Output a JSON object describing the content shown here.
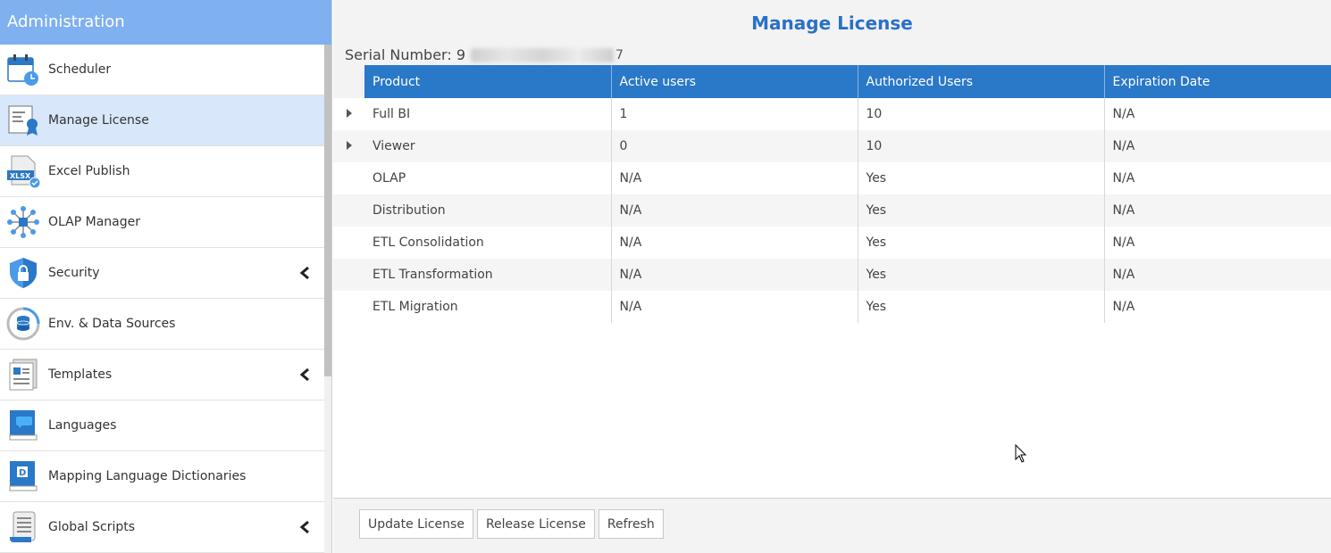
{
  "sidebar": {
    "title": "Administration",
    "items": [
      {
        "label": "Scheduler",
        "icon": "calendar-clock-icon",
        "active": false,
        "expandable": false
      },
      {
        "label": "Manage License",
        "icon": "license-certificate-icon",
        "active": true,
        "expandable": false
      },
      {
        "label": "Excel Publish",
        "icon": "xlsx-file-icon",
        "active": false,
        "expandable": false
      },
      {
        "label": "OLAP Manager",
        "icon": "olap-network-icon",
        "active": false,
        "expandable": false
      },
      {
        "label": "Security",
        "icon": "shield-lock-icon",
        "active": false,
        "expandable": true
      },
      {
        "label": "Env. & Data Sources",
        "icon": "database-icon",
        "active": false,
        "expandable": false
      },
      {
        "label": "Templates",
        "icon": "template-document-icon",
        "active": false,
        "expandable": true
      },
      {
        "label": "Languages",
        "icon": "language-book-icon",
        "active": false,
        "expandable": false
      },
      {
        "label": "Mapping Language Dictionaries",
        "icon": "dictionary-book-icon",
        "active": false,
        "expandable": false
      },
      {
        "label": "Global Scripts",
        "icon": "script-scroll-icon",
        "active": false,
        "expandable": true
      }
    ]
  },
  "main": {
    "title": "Manage License",
    "serial_label": "Serial Number: 9",
    "serial_tail": "7",
    "table": {
      "columns": [
        "Product",
        "Active users",
        "Authorized Users",
        "Expiration Date"
      ],
      "rows": [
        {
          "expandable": true,
          "cells": [
            "Full BI",
            "1",
            "10",
            "N/A"
          ]
        },
        {
          "expandable": true,
          "cells": [
            "Viewer",
            "0",
            "10",
            "N/A"
          ]
        },
        {
          "expandable": false,
          "cells": [
            "OLAP",
            "N/A",
            "Yes",
            "N/A"
          ]
        },
        {
          "expandable": false,
          "cells": [
            "Distribution",
            "N/A",
            "Yes",
            "N/A"
          ]
        },
        {
          "expandable": false,
          "cells": [
            "ETL Consolidation",
            "N/A",
            "Yes",
            "N/A"
          ]
        },
        {
          "expandable": false,
          "cells": [
            "ETL Transformation",
            "N/A",
            "Yes",
            "N/A"
          ]
        },
        {
          "expandable": false,
          "cells": [
            "ETL Migration",
            "N/A",
            "Yes",
            "N/A"
          ]
        }
      ]
    },
    "buttons": {
      "update": "Update License",
      "release": "Release License",
      "refresh": "Refresh"
    }
  },
  "colors": {
    "header_blue": "#2a78c8",
    "sidebar_header": "#7fb0f0",
    "active_item": "#d8e7fa",
    "title_blue": "#2a70c8"
  }
}
